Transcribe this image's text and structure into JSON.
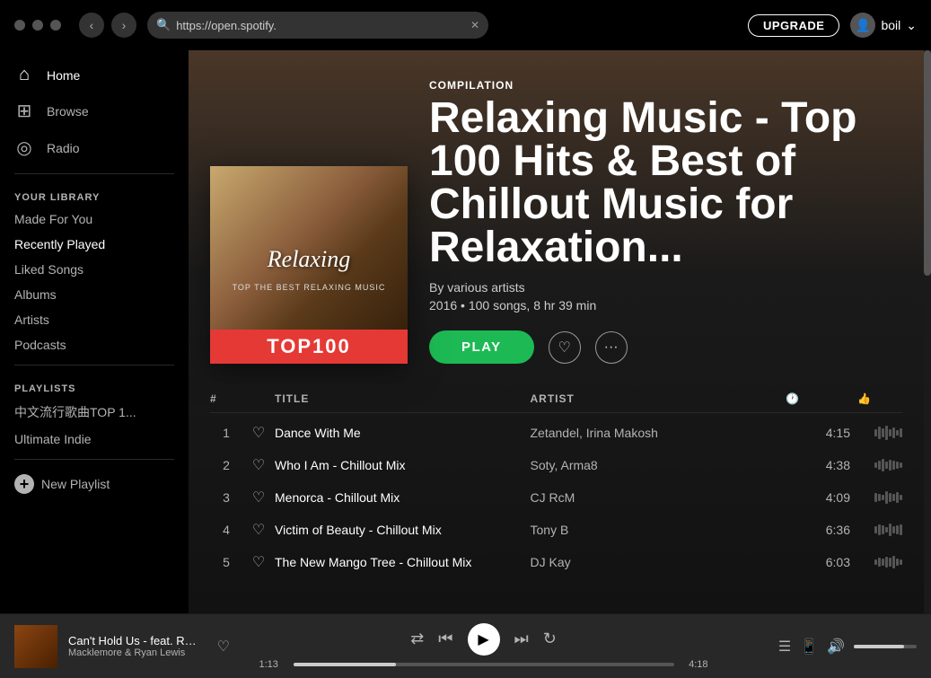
{
  "window": {
    "url": "https://open.spotify.",
    "upgrade_label": "UPGRADE",
    "user_name": "boil"
  },
  "sidebar": {
    "nav": [
      {
        "id": "home",
        "label": "Home",
        "icon": "⌂"
      },
      {
        "id": "browse",
        "label": "Browse",
        "icon": "⊞"
      },
      {
        "id": "radio",
        "label": "Radio",
        "icon": "◎"
      }
    ],
    "your_library_heading": "YOUR LIBRARY",
    "library_links": [
      {
        "id": "made-for-you",
        "label": "Made For You"
      },
      {
        "id": "recently-played",
        "label": "Recently Played"
      },
      {
        "id": "liked-songs",
        "label": "Liked Songs"
      },
      {
        "id": "albums",
        "label": "Albums"
      },
      {
        "id": "artists",
        "label": "Artists"
      },
      {
        "id": "podcasts",
        "label": "Podcasts"
      }
    ],
    "playlists_heading": "PLAYLISTS",
    "playlists": [
      {
        "id": "chinese-top",
        "label": "中文流行歌曲TOP 1..."
      },
      {
        "id": "ultimate-indie",
        "label": "Ultimate Indie"
      }
    ],
    "new_playlist_label": "New Playlist"
  },
  "album": {
    "type": "COMPILATION",
    "title": "Relaxing Music - Top 100 Hits & Best of Chillout Music for Relaxation...",
    "artist_label": "By various artists",
    "meta": "2016 • 100 songs, 8 hr 39 min",
    "cover_title": "Relaxing",
    "cover_subtitle": "TOP THE BEST RELAXING MUSIC",
    "cover_badge": "TOP100",
    "play_label": "PLAY"
  },
  "track_headers": {
    "num": "#",
    "title": "TITLE",
    "artist": "ARTIST",
    "duration_icon": "🕐",
    "like_icon": "👍"
  },
  "tracks": [
    {
      "num": "1",
      "title": "Dance With Me",
      "artist": "Zetandel, Irina Makosh",
      "duration": "4:15"
    },
    {
      "num": "2",
      "title": "Who I Am - Chillout Mix",
      "artist": "Soty, Arma8",
      "duration": "4:38"
    },
    {
      "num": "3",
      "title": "Menorca - Chillout Mix",
      "artist": "CJ RcM",
      "duration": "4:09"
    },
    {
      "num": "4",
      "title": "Victim of Beauty - Chillout Mix",
      "artist": "Tony B",
      "duration": "6:36"
    },
    {
      "num": "5",
      "title": "The New Mango Tree - Chillout Mix",
      "artist": "DJ Kay",
      "duration": "6:03"
    }
  ],
  "player": {
    "track_name": "Can't Hold Us - feat. Ray Dal",
    "artist": "Macklemore & Ryan Lewis",
    "current_time": "1:13",
    "total_time": "4:18",
    "progress_pct": 27
  }
}
